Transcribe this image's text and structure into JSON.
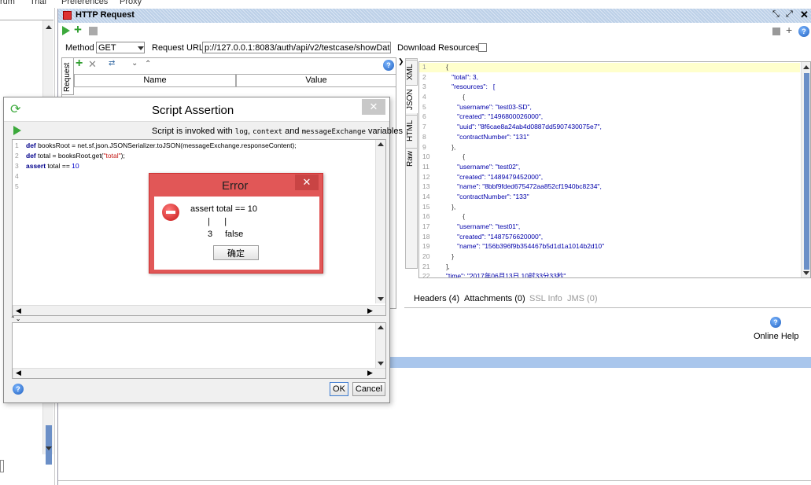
{
  "menu": {
    "items": [
      "rum",
      "Trial",
      "Preferences",
      "Proxy"
    ]
  },
  "window": {
    "title": "HTTP Request"
  },
  "request": {
    "method_label": "Method",
    "method_value": "GET",
    "url_label": "Request URL:",
    "url_value": "p://127.0.0.1:8083/auth/api/v2/testcase/showDatas",
    "download_label": "Download Resources",
    "side_tab": "Request",
    "table_headers": [
      "Name",
      "Value"
    ]
  },
  "response": {
    "tabs": [
      "XML",
      "JSON",
      "HTML",
      "Raw"
    ],
    "json_lines": [
      {
        "n": "1",
        "t": "{"
      },
      {
        "n": "2",
        "t": "   \"total\": 3,"
      },
      {
        "n": "3",
        "t": "   \"resources\":   ["
      },
      {
        "n": "4",
        "t": "         {"
      },
      {
        "n": "5",
        "t": "      \"username\": \"test03-SD\","
      },
      {
        "n": "6",
        "t": "      \"created\": \"1496800026000\","
      },
      {
        "n": "7",
        "t": "      \"uuid\": \"8f6cae8a24ab4d0887dd5907430075e7\","
      },
      {
        "n": "8",
        "t": "      \"contractNumber\": \"131\""
      },
      {
        "n": "9",
        "t": "   },"
      },
      {
        "n": "10",
        "t": "         {"
      },
      {
        "n": "11",
        "t": "      \"username\": \"test02\","
      },
      {
        "n": "12",
        "t": "      \"created\": \"1489479452000\","
      },
      {
        "n": "13",
        "t": "      \"name\": \"8bbf9fded675472aa852cf1940bc8234\","
      },
      {
        "n": "14",
        "t": "      \"contractNumber\": \"133\""
      },
      {
        "n": "15",
        "t": "   },"
      },
      {
        "n": "16",
        "t": "         {"
      },
      {
        "n": "17",
        "t": "      \"username\": \"test01\","
      },
      {
        "n": "18",
        "t": "      \"created\": \"1487576620000\","
      },
      {
        "n": "19",
        "t": "      \"name\": \"156b396f9b354467b5d1d1a1014b2d10\""
      },
      {
        "n": "20",
        "t": "   }"
      },
      {
        "n": "21",
        "t": "],"
      },
      {
        "n": "22",
        "t": "\"time\": \"2017年06月13日 10时33分33秒\""
      }
    ],
    "bottom_tabs": [
      "Headers (4)",
      "Attachments (0)",
      "SSL Info",
      "JMS (0)"
    ],
    "online_help": "Online Help"
  },
  "script_dialog": {
    "title": "Script Assertion",
    "info_prefix": "Script is invoked with",
    "info_var1": "log",
    "info_var2": "context",
    "info_and": "and",
    "info_var3": "messageExchange",
    "info_suffix": "variables",
    "code_lines": [
      {
        "n": "1",
        "kw": "def",
        "rest": " booksRoot = net.sf.json.JSONSerializer.toJSON(messageExchange.responseContent);"
      },
      {
        "n": "2",
        "kw": "def",
        "rest": " total = booksRoot.get(",
        "str": "\"total\"",
        "end": ");"
      },
      {
        "n": "3",
        "kw": "assert",
        "rest": " total == ",
        "num": "10"
      },
      {
        "n": "4"
      },
      {
        "n": "5"
      }
    ],
    "ok_label": "OK",
    "cancel_label": "Cancel"
  },
  "error_dialog": {
    "title": "Error",
    "line1": "assert total == 10",
    "line2": "|      |",
    "line3a": "3",
    "line3b": "false",
    "confirm_label": "确定"
  },
  "colors": {
    "accent": "#1a5fb4",
    "error_title": "#e15757",
    "json_highlight": "#ffffcc"
  }
}
